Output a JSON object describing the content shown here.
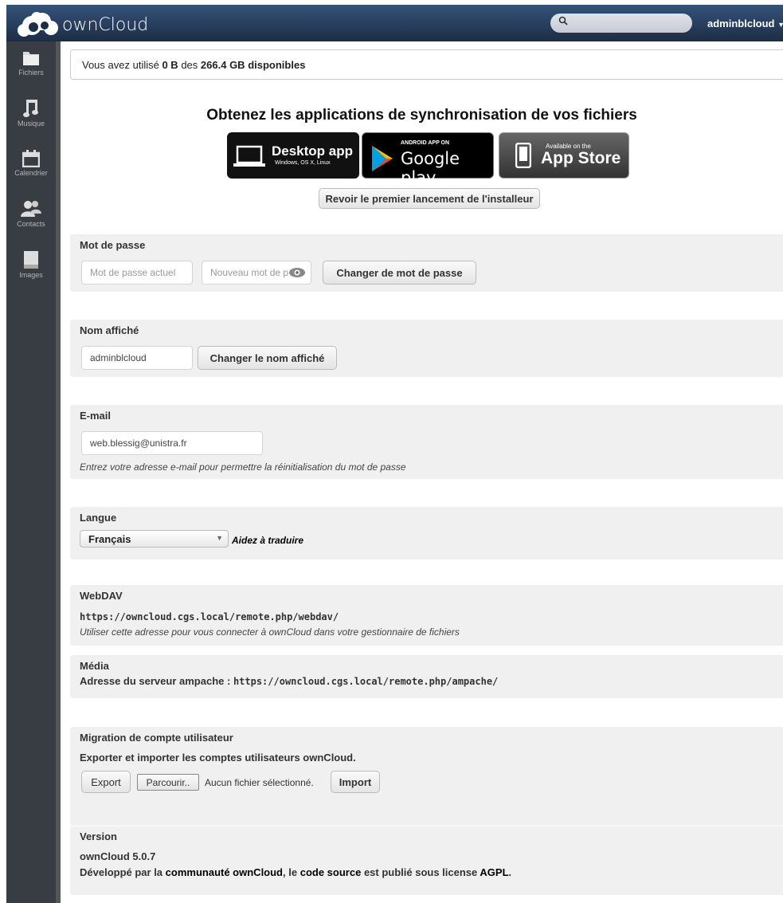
{
  "header": {
    "app_name": "ownCloud",
    "search_placeholder": "",
    "user": "adminblcloud"
  },
  "nav": [
    {
      "label": "Fichiers",
      "icon": "folder-icon"
    },
    {
      "label": "Musique",
      "icon": "music-icon"
    },
    {
      "label": "Calendrier",
      "icon": "calendar-icon"
    },
    {
      "label": "Contacts",
      "icon": "contacts-icon"
    },
    {
      "label": "Images",
      "icon": "images-icon"
    }
  ],
  "quota": {
    "prefix": "Vous avez utilisé",
    "used": "0 B",
    "middle": "des",
    "total": "266.4 GB",
    "suffix": "disponibles"
  },
  "apps": {
    "title": "Obtenez les applications de synchronisation de vos fichiers",
    "desktop_title": "Desktop app",
    "desktop_sub": "Windows, OS X, Linux",
    "gplay_top": "ANDROID APP ON",
    "gplay_main": "Google play",
    "appstore_top": "Available on the",
    "appstore_main": "App Store",
    "wizard_button": "Revoir le premier lancement de l'installeur"
  },
  "password": {
    "title": "Mot de passe",
    "current_placeholder": "Mot de passe actuel",
    "new_placeholder": "Nouveau mot de passe",
    "new_visible": "Nouveau mot de p",
    "button": "Changer de mot de passe"
  },
  "displayname": {
    "title": "Nom affiché",
    "value": "adminblcloud",
    "button": "Changer le nom affiché"
  },
  "email": {
    "title": "E-mail",
    "value": "web.blessig@unistra.fr",
    "hint": "Entrez votre adresse e-mail pour permettre la réinitialisation du mot de passe"
  },
  "language": {
    "title": "Langue",
    "selected": "Français",
    "help_link": "Aidez à traduire"
  },
  "webdav": {
    "title": "WebDAV",
    "url": "https://owncloud.cgs.local/remote.php/webdav/",
    "hint": "Utiliser cette adresse pour vous connecter à ownCloud dans votre gestionnaire de fichiers"
  },
  "media": {
    "title": "Média",
    "label": "Adresse du serveur ampache :",
    "url": "https://owncloud.cgs.local/remote.php/ampache/"
  },
  "migration": {
    "title": "Migration de compte utilisateur",
    "subtitle": "Exporter et importer les comptes utilisateurs ownCloud.",
    "export_button": "Export",
    "browse_button": "Parcourir...",
    "browse_visible": "Parcourir..",
    "no_file": "Aucun fichier sélectionné.",
    "import_button": "Import"
  },
  "version": {
    "title": "Version",
    "number": "ownCloud 5.0.7",
    "dev_prefix": "Développé par la",
    "community_link": "communauté ownCloud",
    "dev_mid": ", le",
    "source_link": "code source",
    "dev_mid2": "est publié sous license",
    "license_link": "AGPL",
    "dev_end": "."
  },
  "colors": {
    "header_top": "#35537a",
    "header_bottom": "#1d2d44",
    "nav_bg": "#383c43",
    "section_bg": "#f0f0f0"
  }
}
